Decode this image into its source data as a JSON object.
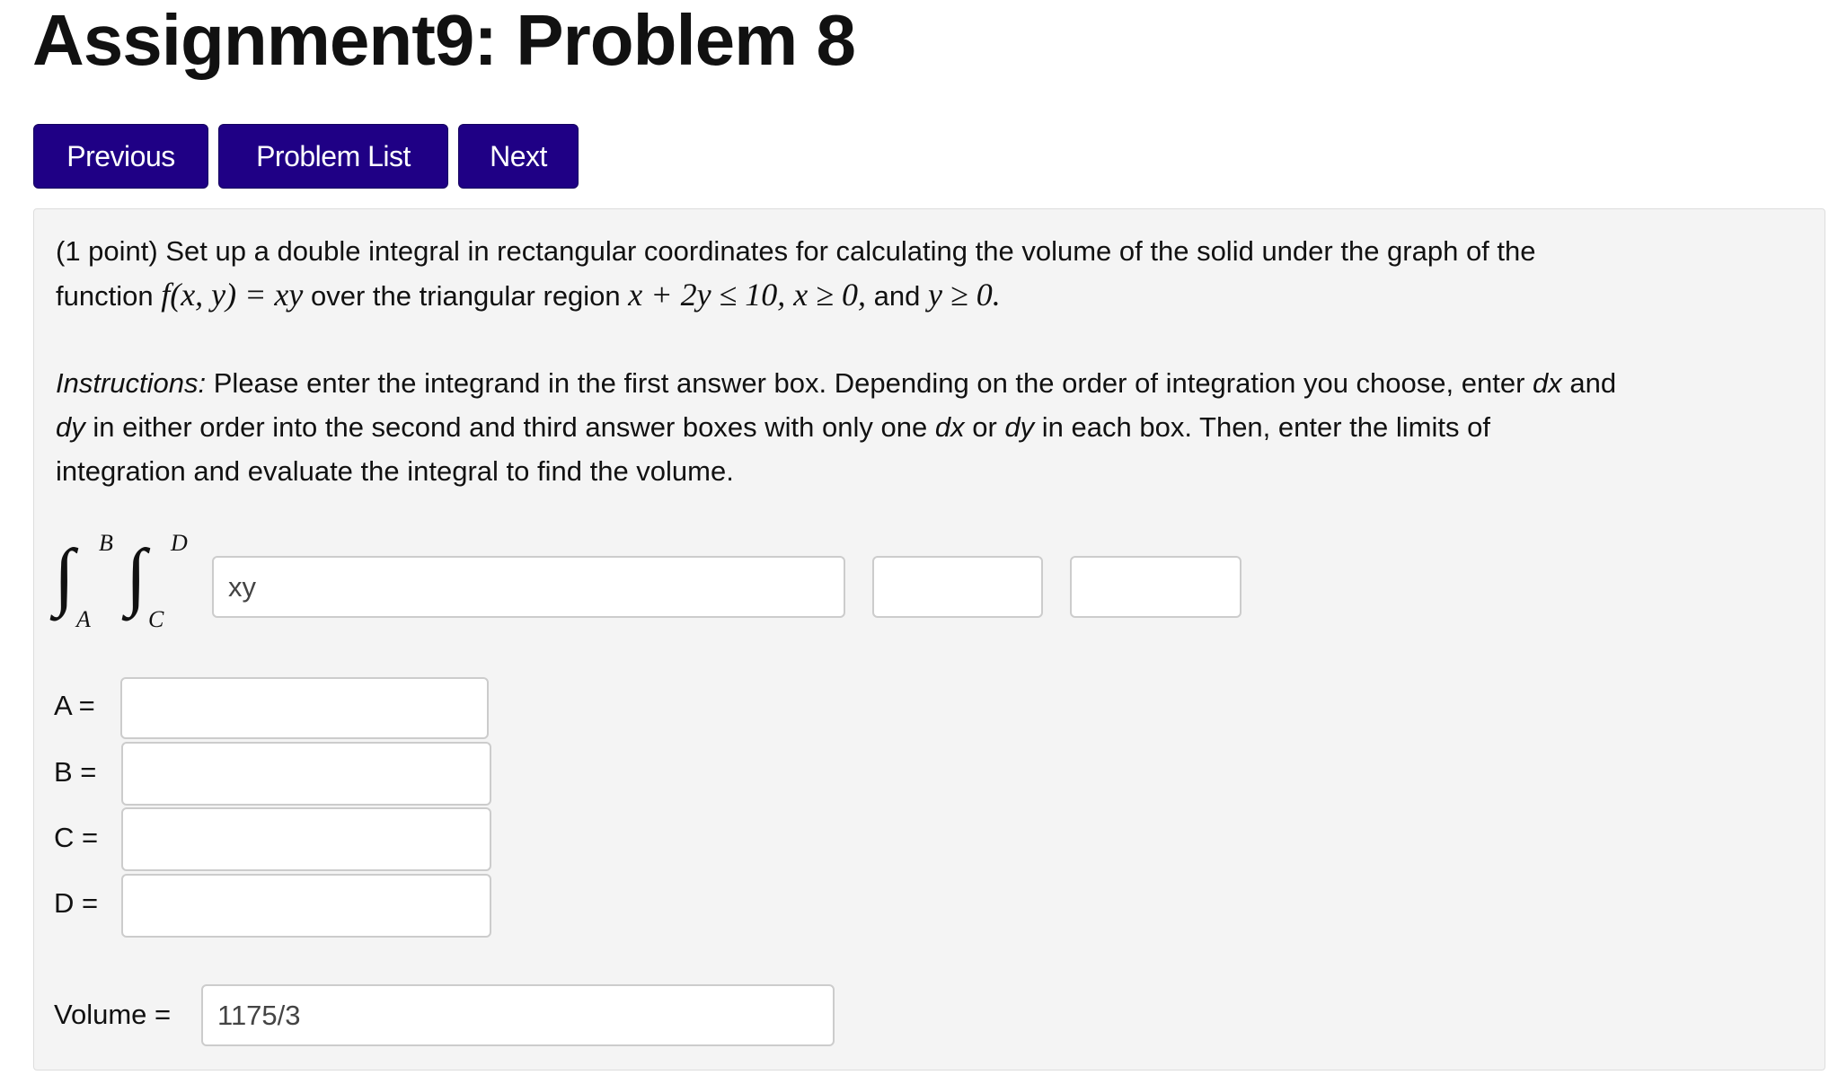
{
  "page_title": "Assignment9: Problem 8",
  "nav": {
    "previous": "Previous",
    "problem_list": "Problem List",
    "next": "Next",
    "button_color": "#1f0085"
  },
  "problem": {
    "points": "(1 point)",
    "line1": "Set up a double integral in rectangular coordinates for calculating the volume of the solid under the graph of the",
    "line2_pre": "function",
    "func": "f(x, y) = xy",
    "line2_mid": "over the triangular region",
    "region": "x + 2y ≤ 10, x ≥ 0,",
    "line2_and": "and",
    "cond": "y ≥ 0.",
    "instructions_label": "Instructions:",
    "instr_a": "Please enter the integrand in the first answer box. Depending on the order of integration you choose, enter",
    "dx": "dx",
    "and": "and",
    "dy": "dy",
    "instr_b": "in either order into the second and third answer boxes with only one",
    "or": "or",
    "instr_c": "in each box. Then, enter the limits of",
    "instr_d": "integration and evaluate the integral to find the volume."
  },
  "integral": {
    "upper_outer": "B",
    "lower_outer": "A",
    "upper_inner": "D",
    "lower_inner": "C",
    "integrand": "xy",
    "diff1": "",
    "diff2": ""
  },
  "limits": [
    {
      "label": "A =",
      "value": ""
    },
    {
      "label": "B =",
      "value": ""
    },
    {
      "label": "C =",
      "value": ""
    },
    {
      "label": "D =",
      "value": ""
    }
  ],
  "volume": {
    "label": "Volume =",
    "value": "1175/3"
  }
}
